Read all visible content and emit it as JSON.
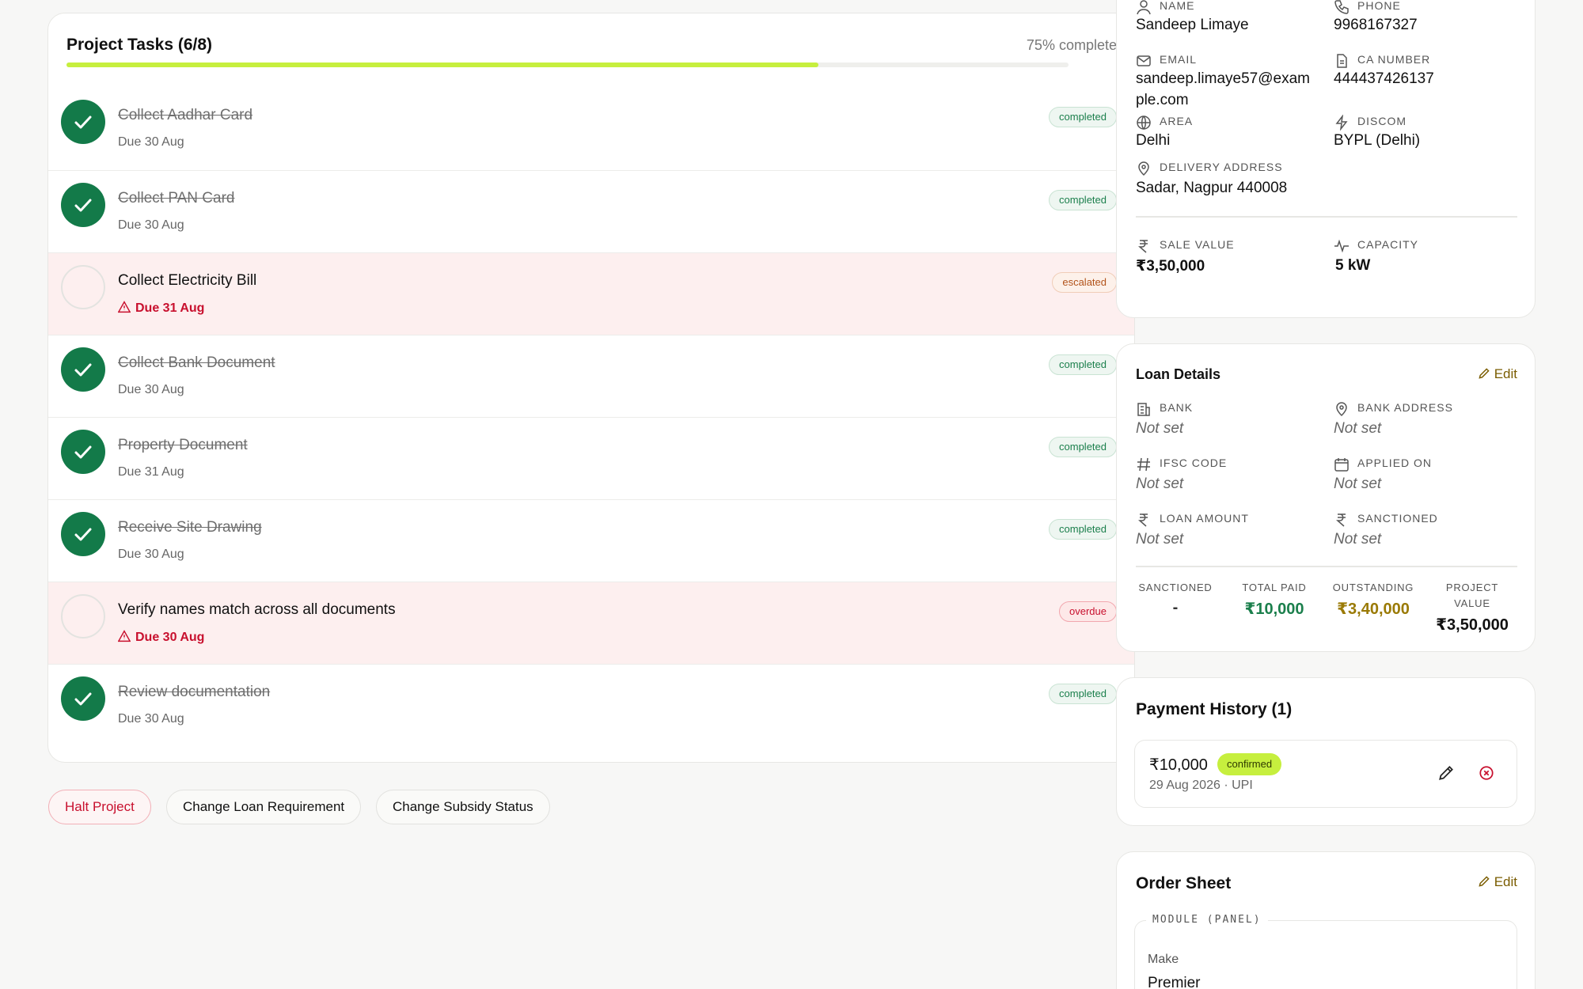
{
  "tasks_card": {
    "title": "Project Tasks (6/8)",
    "progress_text": "75% complete",
    "progress": 0.75,
    "tasks": [
      {
        "name": "Collect Aadhar Card",
        "due": "Due 30 Aug",
        "status": "completed"
      },
      {
        "name": "Collect PAN Card",
        "due": "Due 30 Aug",
        "status": "completed"
      },
      {
        "name": "Collect Electricity Bill",
        "due": "Due 31 Aug",
        "status": "escalated"
      },
      {
        "name": "Collect Bank Document",
        "due": "Due 30 Aug",
        "status": "completed"
      },
      {
        "name": "Property Document",
        "due": "Due 31 Aug",
        "status": "completed"
      },
      {
        "name": "Receive Site Drawing",
        "due": "Due 30 Aug",
        "status": "completed"
      },
      {
        "name": "Verify names match across all documents",
        "due": "Due 30 Aug",
        "status": "overdue"
      },
      {
        "name": "Review documentation",
        "due": "Due 30 Aug",
        "status": "completed"
      }
    ]
  },
  "actions": {
    "halt": "Halt Project",
    "change_loan": "Change Loan Requirement",
    "change_subsidy": "Change Subsidy Status"
  },
  "customer": {
    "name_label": "NAME",
    "name": "Sandeep Limaye",
    "phone_label": "PHONE",
    "phone": "9968167327",
    "email_label": "EMAIL",
    "email_line1": "sandeep.limaye57@exam",
    "email_line2": "ple.com",
    "ca_label": "CA NUMBER",
    "ca": "444437426137",
    "area_label": "AREA",
    "area": "Delhi",
    "discom_label": "DISCOM",
    "discom": "BYPL (Delhi)",
    "address_label": "DELIVERY ADDRESS",
    "address": "Sadar, Nagpur 440008",
    "sale_label": "SALE VALUE",
    "sale": "₹3,50,000",
    "capacity_label": "CAPACITY",
    "capacity": "5 kW"
  },
  "loan": {
    "title": "Loan Details",
    "edit": "Edit",
    "bank_label": "BANK",
    "bank": "Not set",
    "bank_address_label": "BANK ADDRESS",
    "bank_address": "Not set",
    "ifsc_label": "IFSC CODE",
    "ifsc": "Not set",
    "applied_label": "APPLIED ON",
    "applied": "Not set",
    "amount_label": "LOAN AMOUNT",
    "amount": "Not set",
    "sanctioned_label": "SANCTIONED",
    "sanctioned": "Not set",
    "summary": {
      "sanctioned_label": "SANCTIONED",
      "sanctioned": "-",
      "paid_label": "TOTAL PAID",
      "paid": "₹10,000",
      "outstanding_label": "OUTSTANDING",
      "outstanding": "₹3,40,000",
      "project_label_1": "PROJECT",
      "project_label_2": "VALUE",
      "project": "₹3,50,000"
    }
  },
  "payments": {
    "title": "Payment History (1)",
    "amount": "₹10,000",
    "status": "confirmed",
    "meta": "29 Aug 2026 · UPI"
  },
  "order": {
    "title": "Order Sheet",
    "edit": "Edit",
    "section": "MODULE (PANEL)",
    "make_label": "Make",
    "make": "Premier"
  },
  "colors": {
    "progress": "#c6ef3e",
    "done": "#137a49",
    "alert": "#c8102e",
    "paid": "#1b7f4c",
    "outstanding": "#9a7a05"
  },
  "icons": [
    "check-icon",
    "warning-icon",
    "user-icon",
    "phone-icon",
    "mail-icon",
    "document-icon",
    "globe-icon",
    "bolt-icon",
    "pin-icon",
    "rupee-icon",
    "pulse-icon",
    "pencil-icon",
    "bank-icon",
    "hash-icon",
    "calendar-icon",
    "close-circle-icon"
  ]
}
